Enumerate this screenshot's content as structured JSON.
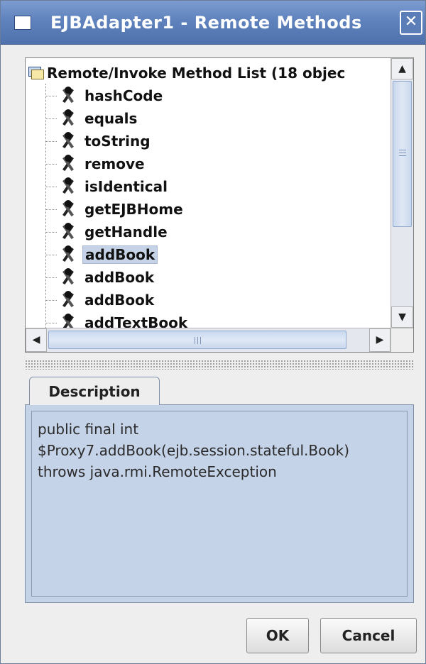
{
  "window": {
    "title": "EJBAdapter1 - Remote Methods",
    "close_glyph": "✕"
  },
  "tree": {
    "root_label": "Remote/Invoke Method List (18 objec",
    "root_icon": "list-folder-icon",
    "method_icon": "method-icon",
    "items": [
      {
        "label": "hashCode",
        "selected": false
      },
      {
        "label": "equals",
        "selected": false
      },
      {
        "label": "toString",
        "selected": false
      },
      {
        "label": "remove",
        "selected": false
      },
      {
        "label": "isIdentical",
        "selected": false
      },
      {
        "label": "getEJBHome",
        "selected": false
      },
      {
        "label": "getHandle",
        "selected": false
      },
      {
        "label": "addBook",
        "selected": true
      },
      {
        "label": "addBook",
        "selected": false
      },
      {
        "label": "addBook",
        "selected": false
      },
      {
        "label": "addTextBook",
        "selected": false
      }
    ]
  },
  "scrollbars": {
    "up_glyph": "▲",
    "down_glyph": "▼",
    "left_glyph": "◀",
    "right_glyph": "▶"
  },
  "description": {
    "tab_label": "Description",
    "lines": [
      "public final int",
      "$Proxy7.addBook(ejb.session.stateful.Book)",
      "throws java.rmi.RemoteException"
    ]
  },
  "buttons": {
    "ok_label": "OK",
    "cancel_label": "Cancel"
  },
  "colors": {
    "titlebar": "#5f82bd",
    "selection": "#c6d3e6",
    "description_bg": "#c5d3e8"
  }
}
